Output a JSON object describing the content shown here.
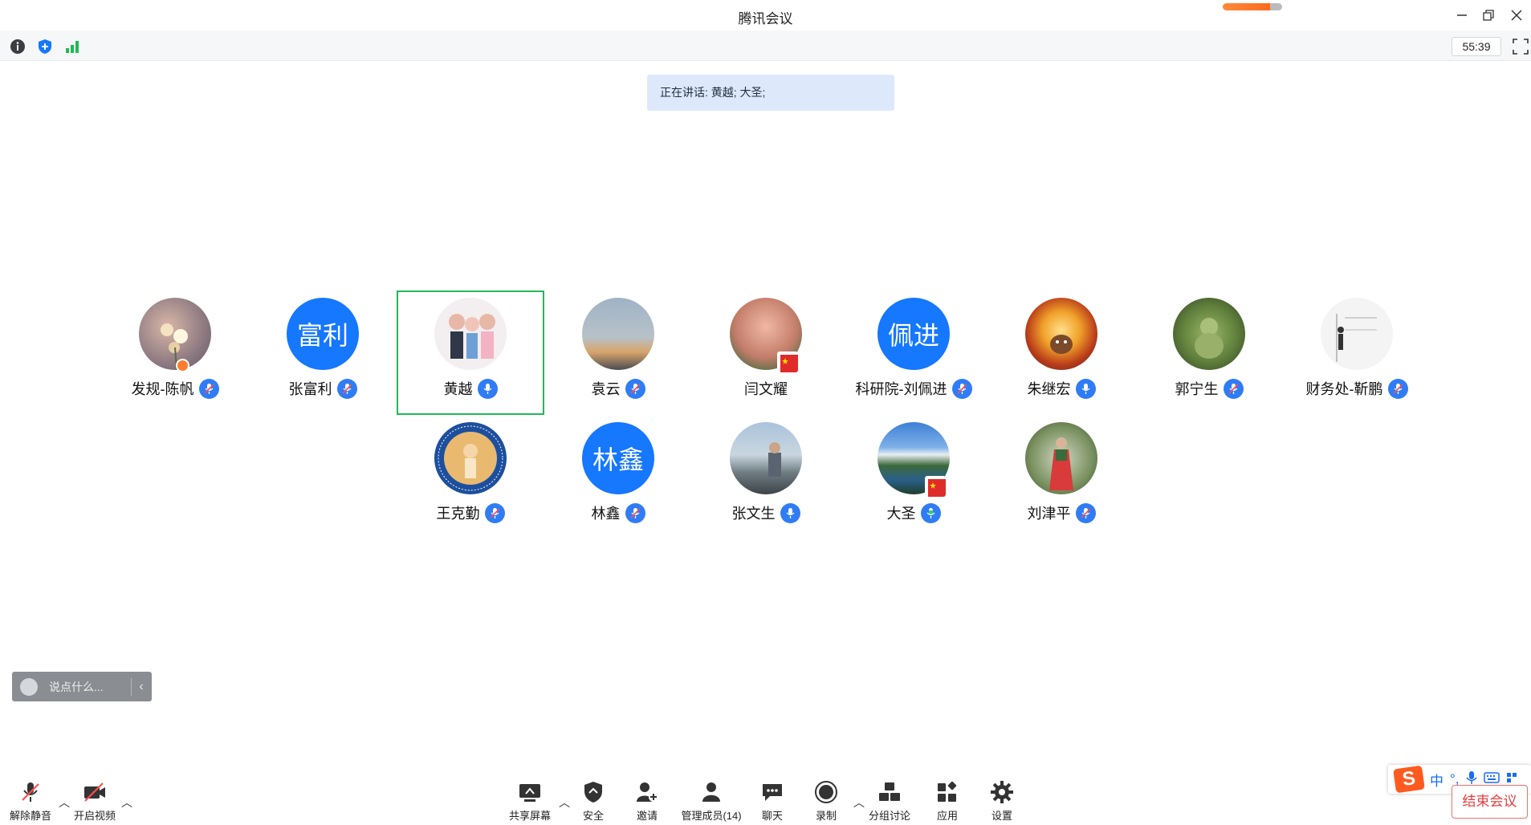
{
  "window": {
    "title": "腾讯会议"
  },
  "toolbar": {
    "timer": "55:39"
  },
  "speaking": {
    "text": "正在讲话: 黄越; 大圣;"
  },
  "participants": [
    {
      "name": "发规-陈帆",
      "avatar_text": "",
      "mic": "muted"
    },
    {
      "name": "张富利",
      "avatar_text": "富利",
      "mic": "muted"
    },
    {
      "name": "黄越",
      "avatar_text": "",
      "mic": "on"
    },
    {
      "name": "袁云",
      "avatar_text": "",
      "mic": "muted"
    },
    {
      "name": "闫文耀",
      "avatar_text": "",
      "mic": "none"
    },
    {
      "name": "科研院-刘佩进",
      "avatar_text": "佩进",
      "mic": "muted"
    },
    {
      "name": "朱继宏",
      "avatar_text": "",
      "mic": "on"
    },
    {
      "name": "郭宁生",
      "avatar_text": "",
      "mic": "muted"
    },
    {
      "name": "财务处-靳鹏",
      "avatar_text": "",
      "mic": "muted"
    },
    {
      "name": "王克勤",
      "avatar_text": "",
      "mic": "muted"
    },
    {
      "name": "林鑫",
      "avatar_text": "林鑫",
      "mic": "muted"
    },
    {
      "name": "张文生",
      "avatar_text": "",
      "mic": "on"
    },
    {
      "name": "大圣",
      "avatar_text": "",
      "mic": "speaking"
    },
    {
      "name": "刘津平",
      "avatar_text": "",
      "mic": "muted"
    }
  ],
  "chat": {
    "placeholder": "说点什么..."
  },
  "bottom": {
    "unmute": "解除静音",
    "video": "开启视频",
    "share": "共享屏幕",
    "security": "安全",
    "invite": "邀请",
    "manage": "管理成员(14)",
    "chat": "聊天",
    "record": "录制",
    "breakout": "分组讨论",
    "apps": "应用",
    "settings": "设置",
    "end": "结束会议"
  },
  "ime": {
    "mode": "中",
    "punct": "°,"
  },
  "colors": {
    "accent": "#1677ff",
    "active_border": "#22b856",
    "end_red": "#e63c3c"
  }
}
